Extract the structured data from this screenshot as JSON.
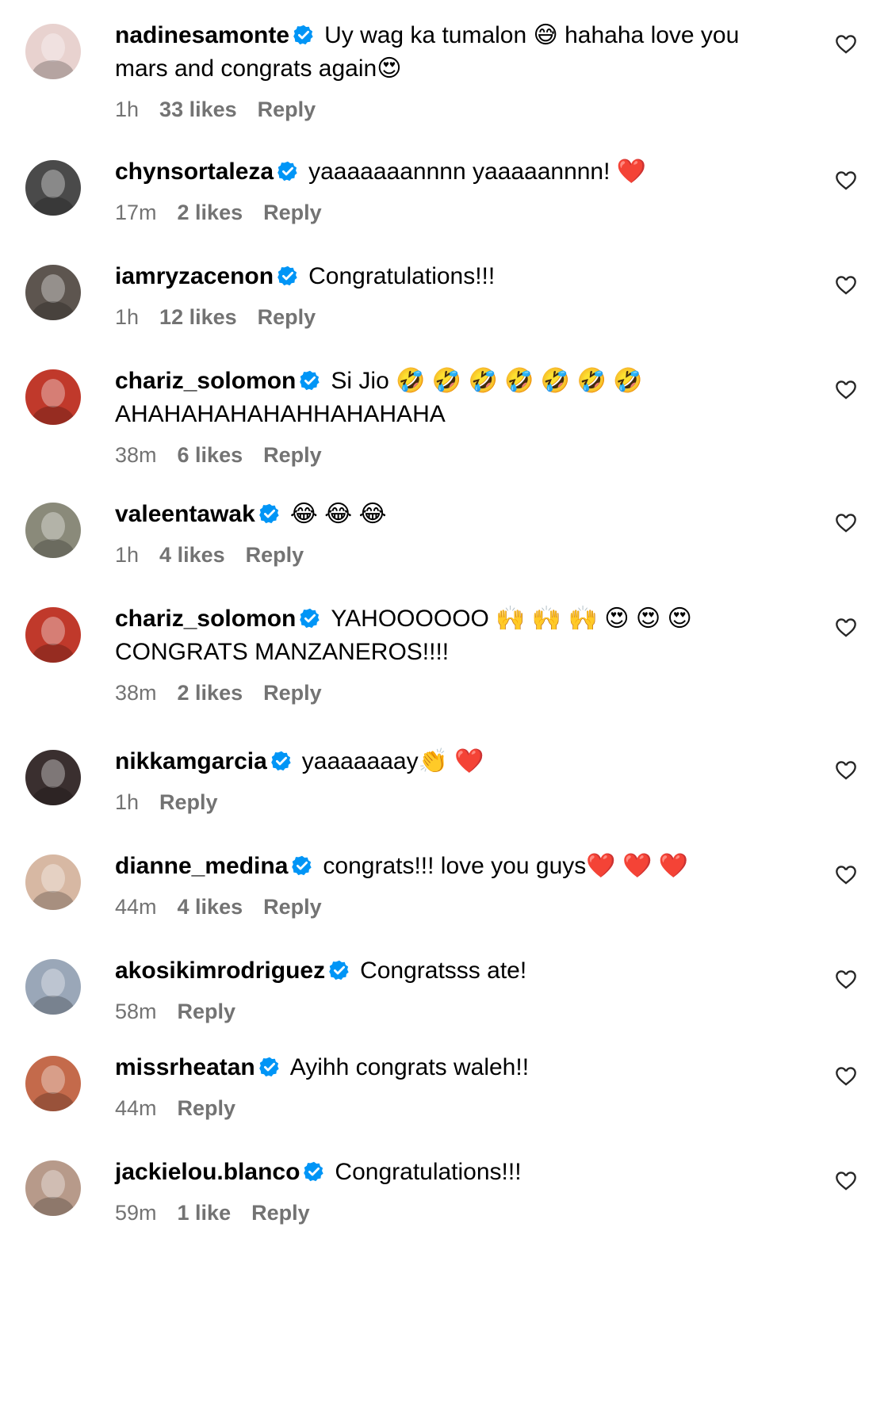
{
  "colors": {
    "verified_blue": "#0095f6",
    "meta_gray": "#737373",
    "text": "#000000"
  },
  "comments": [
    {
      "username": "nadinesamonte",
      "verified": true,
      "text": "Uy wag ka tumalon 😅 hahaha love you mars and congrats again😍",
      "time": "1h",
      "likes": "33 likes",
      "reply": "Reply",
      "avatar_color": "#e8d2cf"
    },
    {
      "username": "chynsortaleza",
      "verified": true,
      "text": "yaaaaaaannnn yaaaaannnn! ❤️",
      "time": "17m",
      "likes": "2 likes",
      "reply": "Reply",
      "avatar_color": "#4a4a4a"
    },
    {
      "username": "iamryzacenon",
      "verified": true,
      "text": "Congratulations!!!",
      "time": "1h",
      "likes": "12 likes",
      "reply": "Reply",
      "avatar_color": "#5d554f"
    },
    {
      "username": "chariz_solomon",
      "verified": true,
      "text": "Si Jio 🤣 🤣 🤣 🤣 🤣 🤣 🤣 AHAHAHAHAHAHHAHAHAHA",
      "time": "38m",
      "likes": "6 likes",
      "reply": "Reply",
      "avatar_color": "#c0392b"
    },
    {
      "username": "valeentawak",
      "verified": true,
      "text": "😂 😂 😂",
      "time": "1h",
      "likes": "4 likes",
      "reply": "Reply",
      "avatar_color": "#8a8a7a"
    },
    {
      "username": "chariz_solomon",
      "verified": true,
      "text": "YAHOOOOOO 🙌 🙌 🙌 😍 😍 😍 CONGRATS MANZANEROS!!!!",
      "time": "38m",
      "likes": "2 likes",
      "reply": "Reply",
      "avatar_color": "#c0392b"
    },
    {
      "username": "nikkamgarcia",
      "verified": true,
      "text": "yaaaaaaay👏 ❤️",
      "time": "1h",
      "likes": "",
      "reply": "Reply",
      "avatar_color": "#3a2f2f"
    },
    {
      "username": "dianne_medina",
      "verified": true,
      "text": "congrats!!! love you guys❤️ ❤️ ❤️",
      "time": "44m",
      "likes": "4 likes",
      "reply": "Reply",
      "avatar_color": "#d7b8a3"
    },
    {
      "username": "akosikimrodriguez",
      "verified": true,
      "text": "Congratsss ate!",
      "time": "58m",
      "likes": "",
      "reply": "Reply",
      "avatar_color": "#9aa7b8"
    },
    {
      "username": "missrheatan",
      "verified": true,
      "text": "Ayihh congrats waleh!!",
      "time": "44m",
      "likes": "",
      "reply": "Reply",
      "avatar_color": "#c46a4b"
    },
    {
      "username": "jackielou.blanco",
      "verified": true,
      "text": "Congratulations!!!",
      "time": "59m",
      "likes": "1 like",
      "reply": "Reply",
      "avatar_color": "#b79a8a"
    }
  ]
}
